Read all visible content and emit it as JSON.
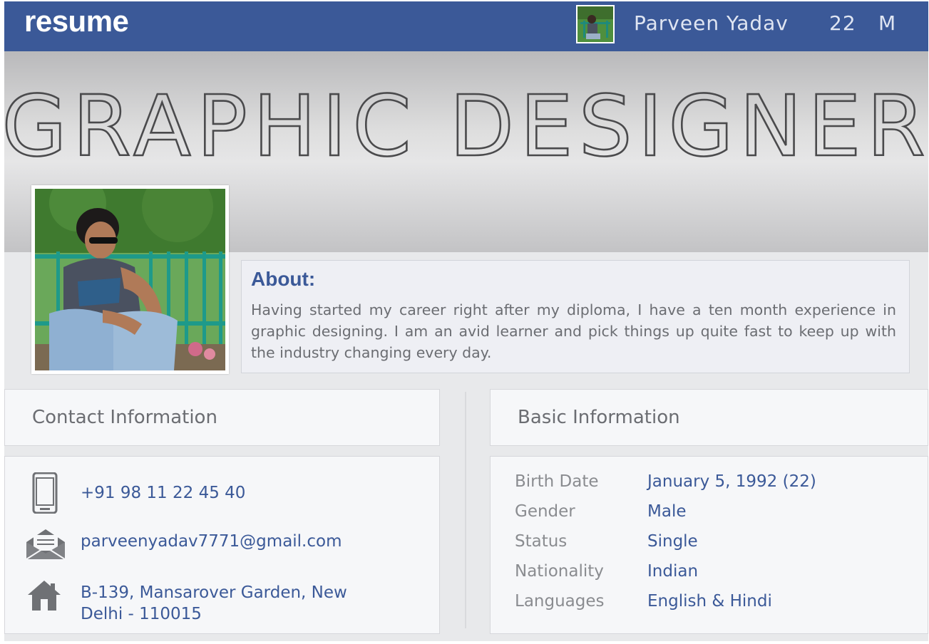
{
  "topbar": {
    "logo": "resume",
    "user_name": "Parveen Yadav",
    "user_age": "22",
    "user_gender": "M",
    "accent_color": "#3b5998"
  },
  "cover": {
    "title": "GRAPHIC DESIGNER"
  },
  "about": {
    "heading": "About:",
    "text": "Having started my career right after my diploma, I have a ten month experience in graphic designing. I am an avid learner and pick things up quite fast to keep up with the industry changing every day."
  },
  "contact": {
    "heading": "Contact Information",
    "phone": "+91 98 11 22 45 40",
    "email": "parveenyadav7771@gmail.com",
    "address_line1": "B-139, Mansarover Garden, New",
    "address_line2": "Delhi - 110015",
    "icons": [
      "phone-icon",
      "envelope-icon",
      "home-icon"
    ]
  },
  "basic": {
    "heading": "Basic Information",
    "rows": [
      {
        "label": "Birth Date",
        "value": "January 5, 1992 (22)"
      },
      {
        "label": "Gender",
        "value": "Male"
      },
      {
        "label": "Status",
        "value": "Single"
      },
      {
        "label": "Nationality",
        "value": "Indian"
      },
      {
        "label": "Languages",
        "value": "English & Hindi"
      }
    ]
  }
}
